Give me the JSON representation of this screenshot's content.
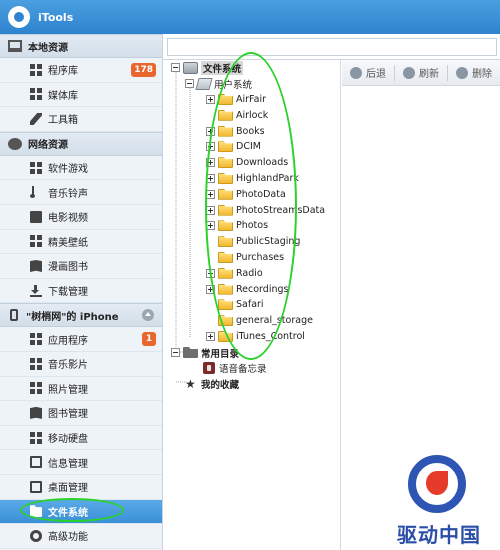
{
  "app": {
    "title": "iTools"
  },
  "sidebar": {
    "local": {
      "header": "本地资源",
      "items": [
        {
          "label": "程序库",
          "badge": "178"
        },
        {
          "label": "媒体库"
        },
        {
          "label": "工具箱"
        }
      ]
    },
    "network": {
      "header": "网络资源",
      "items": [
        {
          "label": "软件游戏"
        },
        {
          "label": "音乐铃声"
        },
        {
          "label": "电影视频"
        },
        {
          "label": "精美壁纸"
        },
        {
          "label": "漫画图书"
        },
        {
          "label": "下载管理"
        }
      ]
    },
    "device": {
      "header": "\"树梢网\"的 iPhone",
      "items": [
        {
          "label": "应用程序",
          "badge": "1"
        },
        {
          "label": "音乐影片"
        },
        {
          "label": "照片管理"
        },
        {
          "label": "图书管理"
        },
        {
          "label": "移动硬盘"
        },
        {
          "label": "信息管理"
        },
        {
          "label": "桌面管理"
        },
        {
          "label": "文件系统",
          "active": true
        },
        {
          "label": "高级功能"
        }
      ]
    }
  },
  "toolbar": {
    "back": "后退",
    "refresh": "刷新",
    "delete": "删除"
  },
  "tree": {
    "root": "文件系统",
    "user_system": "用户系统",
    "folders": [
      "AirFair",
      "Airlock",
      "Books",
      "DCIM",
      "Downloads",
      "HighlandPark",
      "PhotoData",
      "PhotoStreamsData",
      "Photos",
      "PublicStaging",
      "Purchases",
      "Radio",
      "Recordings",
      "Safari",
      "general_storage",
      "iTunes_Control"
    ],
    "common_dirs": "常用目录",
    "voice_memo": "语音备忘录",
    "favorites": "我的收藏"
  },
  "watermark": {
    "text": "驱动中国"
  }
}
